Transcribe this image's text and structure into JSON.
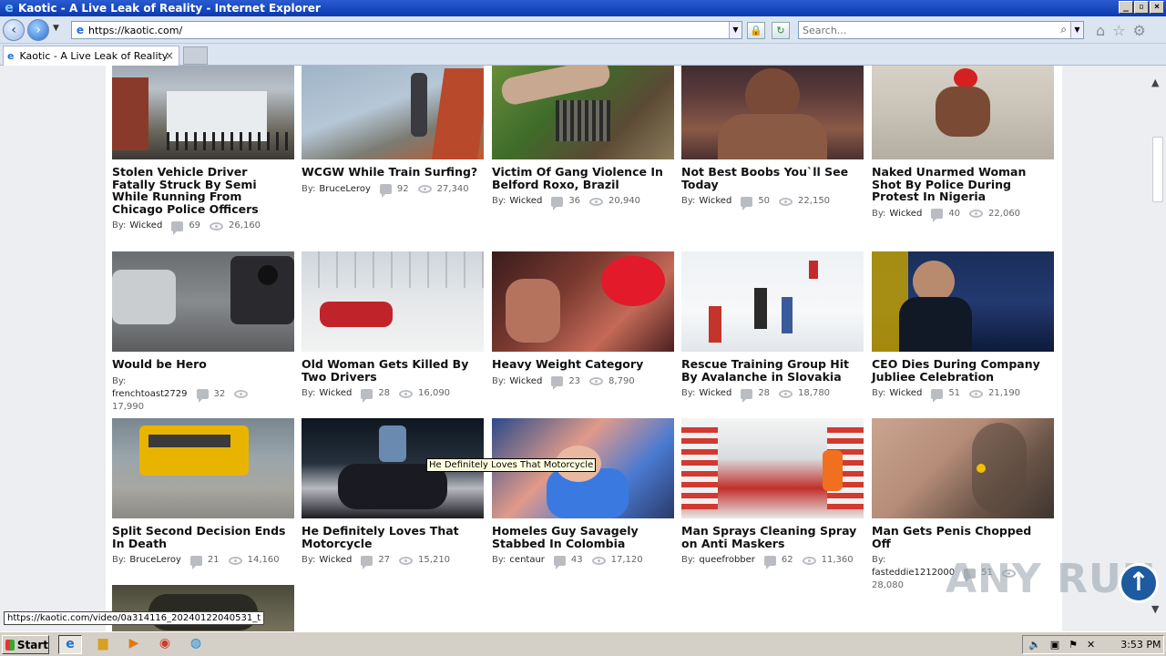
{
  "window": {
    "title": "Kaotic - A Live Leak of Reality - Internet Explorer",
    "btn_min": "_",
    "btn_max": "▫",
    "btn_close": "×"
  },
  "address": {
    "url": "https://kaotic.com/",
    "search_placeholder": "Search..."
  },
  "tab": {
    "label": "Kaotic - A Live Leak of Reality",
    "close": "×"
  },
  "by_label": "By:",
  "videos": [
    {
      "title": "Stolen Vehicle Driver Fatally Struck By Semi While Running From Chicago Police Officers",
      "author": "Wicked",
      "comments": "69",
      "views": "26,160"
    },
    {
      "title": "WCGW While Train Surfing?",
      "author": "BruceLeroy",
      "comments": "92",
      "views": "27,340"
    },
    {
      "title": "Victim Of Gang Violence In Belford Roxo, Brazil",
      "author": "Wicked",
      "comments": "36",
      "views": "20,940"
    },
    {
      "title": "Not Best Boobs You`ll See Today",
      "author": "Wicked",
      "comments": "50",
      "views": "22,150"
    },
    {
      "title": "Naked Unarmed Woman Shot By Police During Protest In Nigeria",
      "author": "Wicked",
      "comments": "40",
      "views": "22,060"
    },
    {
      "title": "Would be Hero",
      "author": "frenchtoast2729",
      "comments": "32",
      "views": "17,990"
    },
    {
      "title": "Old Woman Gets Killed By Two Drivers",
      "author": "Wicked",
      "comments": "28",
      "views": "16,090"
    },
    {
      "title": "Heavy Weight Category",
      "author": "Wicked",
      "comments": "23",
      "views": "8,790"
    },
    {
      "title": "Rescue Training Group Hit By Avalanche in Slovakia",
      "author": "Wicked",
      "comments": "28",
      "views": "18,780"
    },
    {
      "title": "CEO Dies During Company Jubliee Celebration",
      "author": "Wicked",
      "comments": "51",
      "views": "21,190"
    },
    {
      "title": "Split Second Decision Ends In Death",
      "author": "BruceLeroy",
      "comments": "21",
      "views": "14,160"
    },
    {
      "title": "He Definitely Loves That Motorcycle",
      "author": "Wicked",
      "comments": "27",
      "views": "15,210"
    },
    {
      "title": "Homeles Guy Savagely Stabbed In Colombia",
      "author": "centaur",
      "comments": "43",
      "views": "17,120"
    },
    {
      "title": "Man Sprays Cleaning Spray on Anti Maskers",
      "author": "queefrobber",
      "comments": "62",
      "views": "11,360"
    },
    {
      "title": "Man Gets Penis Chopped Off",
      "author": "fasteddie1212000",
      "comments": "51",
      "views": "28,080"
    }
  ],
  "tooltip": "He Definitely Loves That Motorcycle",
  "status_url": "https://kaotic.com/video/0a314116_20240122040531_t",
  "watermark": "ANY RUN",
  "taskbar": {
    "start_label": "Start",
    "clock": "3:53 PM"
  },
  "colors": {
    "titlebar": "#0a3ab0",
    "uparrow": "#1e5aa0"
  }
}
